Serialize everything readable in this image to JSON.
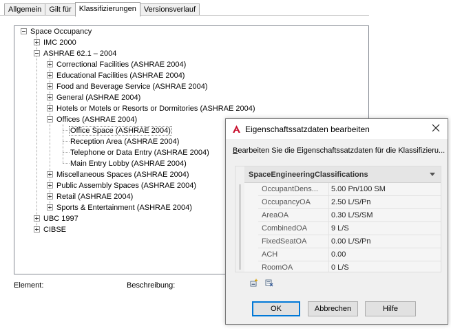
{
  "tabs": [
    {
      "label": "Allgemein"
    },
    {
      "label": "Gilt für"
    },
    {
      "label": "Klassifizierungen"
    },
    {
      "label": "Versionsverlauf"
    }
  ],
  "tree": {
    "nodes": [
      {
        "label": "Space Occupancy"
      },
      {
        "label": "IMC 2000"
      },
      {
        "label": "ASHRAE 62.1 – 2004"
      },
      {
        "label": "Correctional Facilities (ASHRAE 2004)"
      },
      {
        "label": "Educational Facilities (ASHRAE 2004)"
      },
      {
        "label": "Food and Beverage Service (ASHRAE 2004)"
      },
      {
        "label": "General (ASHRAE 2004)"
      },
      {
        "label": "Hotels or Motels or Resorts or Dormitories (ASHRAE 2004)"
      },
      {
        "label": "Offices (ASHRAE 2004)"
      },
      {
        "label": "Office Space (ASHRAE 2004)"
      },
      {
        "label": "Reception Area (ASHRAE 2004)"
      },
      {
        "label": "Telephone or Data Entry (ASHRAE 2004)"
      },
      {
        "label": "Main Entry Lobby (ASHRAE 2004)"
      },
      {
        "label": "Miscellaneous Spaces (ASHRAE 2004)"
      },
      {
        "label": "Public Assembly Spaces (ASHRAE 2004)"
      },
      {
        "label": "Retail (ASHRAE 2004)"
      },
      {
        "label": "Sports & Entertainment (ASHRAE 2004)"
      },
      {
        "label": "UBC 1997"
      },
      {
        "label": "CIBSE"
      }
    ]
  },
  "footer": {
    "element_label_pre": "Element",
    "element_label_u": "",
    "element_label_post": ":",
    "description_label_pre": "Beschreibung",
    "description_label_post": ":"
  },
  "dialog": {
    "title": "Eigenschaftssatzdaten bearbeiten",
    "message_u": "B",
    "message_rest": "earbeiten Sie die Eigenschaftssatzdaten für die Klassifizieru...",
    "grid_header": "SpaceEngineeringClassifications",
    "rows": [
      {
        "key": "OccupantDens...",
        "value": "5.00 Pn/100 SM"
      },
      {
        "key": "OccupancyOA",
        "value": "2.50  L/S/Pn"
      },
      {
        "key": "AreaOA",
        "value": "0.30 L/S/SM"
      },
      {
        "key": "CombinedOA",
        "value": "9 L/S"
      },
      {
        "key": "FixedSeatOA",
        "value": "0.00  L/S/Pn"
      },
      {
        "key": "ACH",
        "value": "0.00"
      },
      {
        "key": "RoomOA",
        "value": "0 L/S"
      }
    ],
    "ok_label": "OK",
    "cancel_label": "Abbrechen",
    "help_label": "Hilfe"
  },
  "icons": {
    "app": "autocad-a-icon",
    "close": "close-icon",
    "add_propertyset": "add-property-set-icon",
    "remove_propertyset": "remove-property-set-icon"
  },
  "colors": {
    "app_icon_red": "#c8102e",
    "default_button_border": "#0078d7"
  }
}
